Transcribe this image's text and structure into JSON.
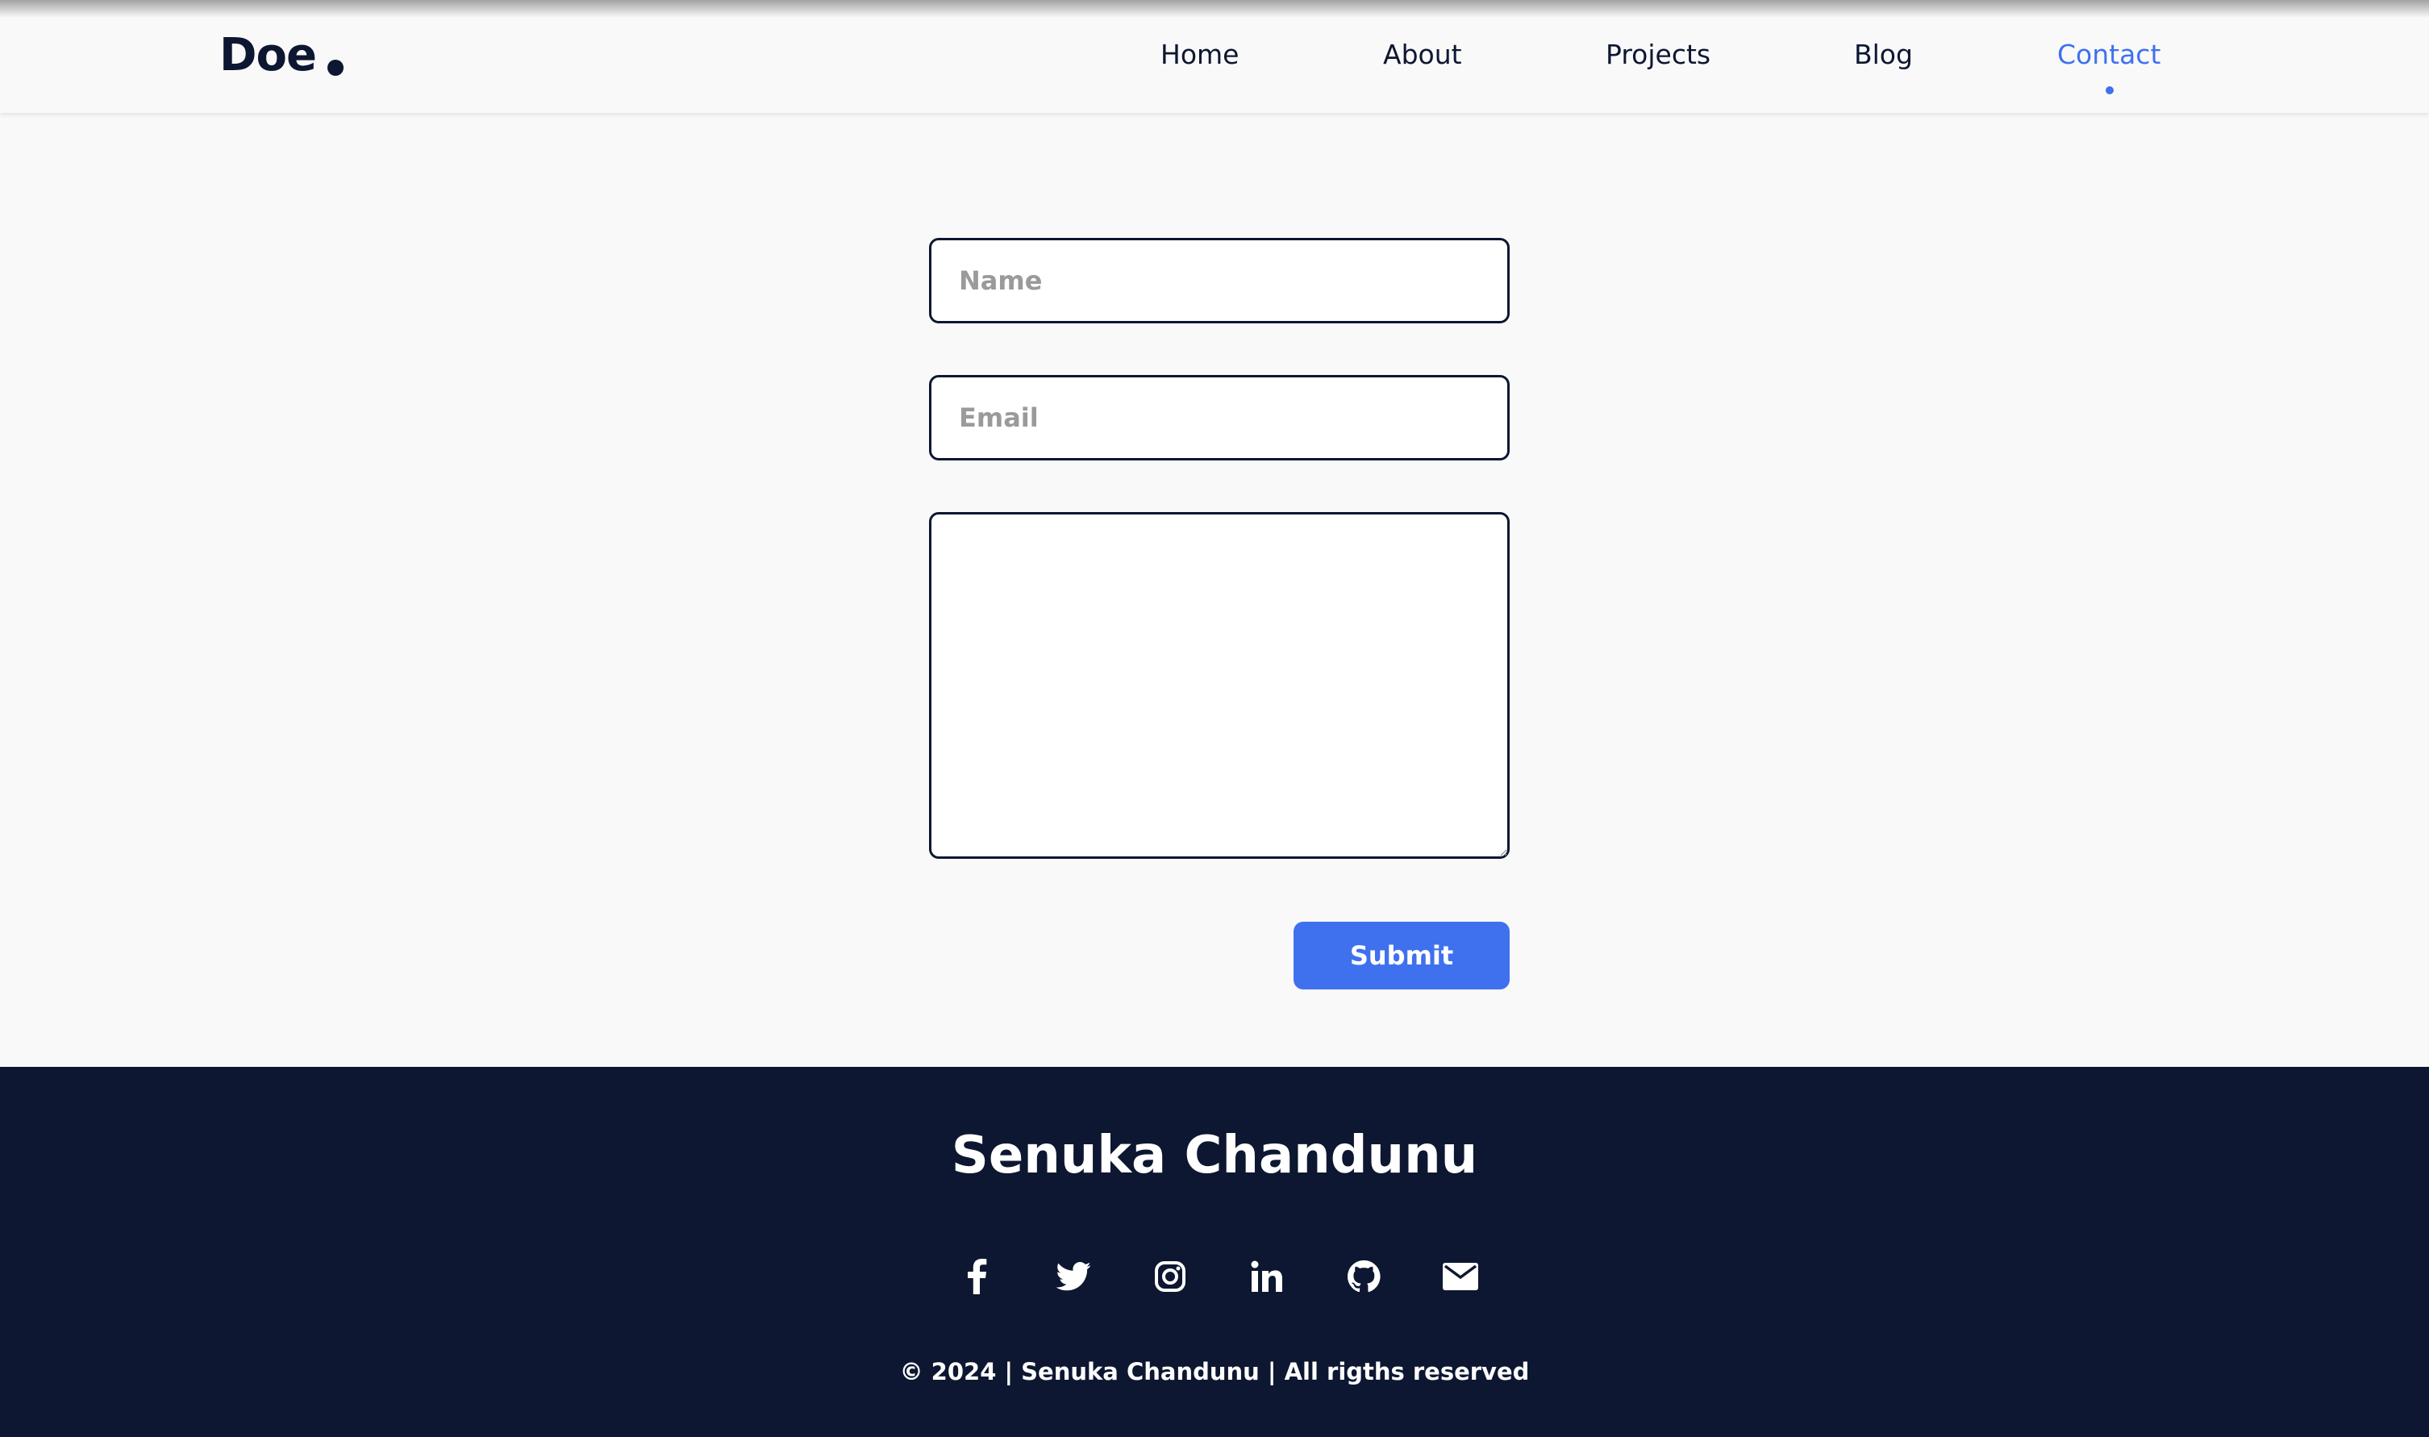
{
  "brand": {
    "name": "Doe"
  },
  "nav": {
    "items": [
      {
        "label": "Home",
        "active": false
      },
      {
        "label": "About",
        "active": false
      },
      {
        "label": "Projects",
        "active": false
      },
      {
        "label": "Blog",
        "active": false
      },
      {
        "label": "Contact",
        "active": true
      }
    ]
  },
  "form": {
    "name_placeholder": "Name",
    "email_placeholder": "Email",
    "message_placeholder": "",
    "submit_label": "Submit"
  },
  "footer": {
    "name": "Senuka Chandunu",
    "social_icons": [
      "facebook-icon",
      "twitter-icon",
      "instagram-icon",
      "linkedin-icon",
      "github-icon",
      "mail-icon"
    ],
    "copyright": "© 2024 | Senuka Chandunu | All rigths reserved"
  },
  "colors": {
    "accent": "#3f71ee",
    "dark": "#0d1731",
    "background": "#f9f9f9"
  }
}
